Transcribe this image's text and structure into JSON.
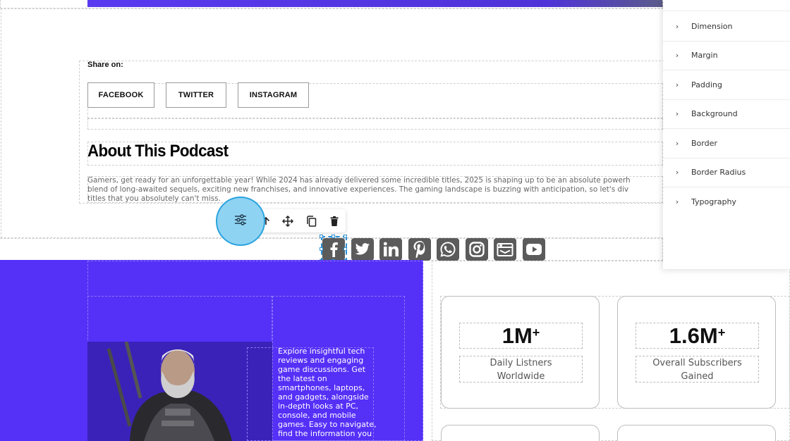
{
  "share": {
    "label": "Share on:",
    "buttons": [
      "FACEBOOK",
      "TWITTER",
      "INSTAGRAM"
    ]
  },
  "podcast": {
    "heading": "About This Podcast",
    "paragraph_lines": [
      "Gamers, get ready for an unforgettable year! While 2024 has already delivered some incredible titles, 2025 is shaping up to be an absolute powerh",
      "blend of long-awaited sequels, exciting new franchises, and innovative experiences. The gaming landscape is buzzing with anticipation, so let's div",
      "titles that you absolutely can't miss."
    ]
  },
  "toolbar": {
    "icons": [
      "settings-icon",
      "arrow-up-icon",
      "move-icon",
      "duplicate-icon",
      "delete-icon"
    ]
  },
  "social_icons": [
    "facebook-icon",
    "twitter-icon",
    "linkedin-icon",
    "pinterest-icon",
    "whatsapp-icon",
    "instagram-icon",
    "email-icon",
    "youtube-icon"
  ],
  "hero": {
    "text": "Explore insightful tech reviews and engaging game discussions. Get the latest on smartphones, laptops, and gadgets, alongside in-depth looks at PC, console, and mobile games. Easy to navigate, find the information you"
  },
  "stats": [
    {
      "number": "1M",
      "suffix": "+",
      "label_lines": [
        "Daily Listners",
        "Worldwide"
      ]
    },
    {
      "number": "1.6M",
      "suffix": "+",
      "label_lines": [
        "Overall Subscribers",
        "Gained"
      ]
    }
  ],
  "panel": {
    "items": [
      "Dimension",
      "Margin",
      "Padding",
      "Background",
      "Border",
      "Border Radius",
      "Typography"
    ]
  },
  "colors": {
    "purple": "#5530f7",
    "selection": "#2d8fd5",
    "social_bg": "#5b5b5b"
  }
}
